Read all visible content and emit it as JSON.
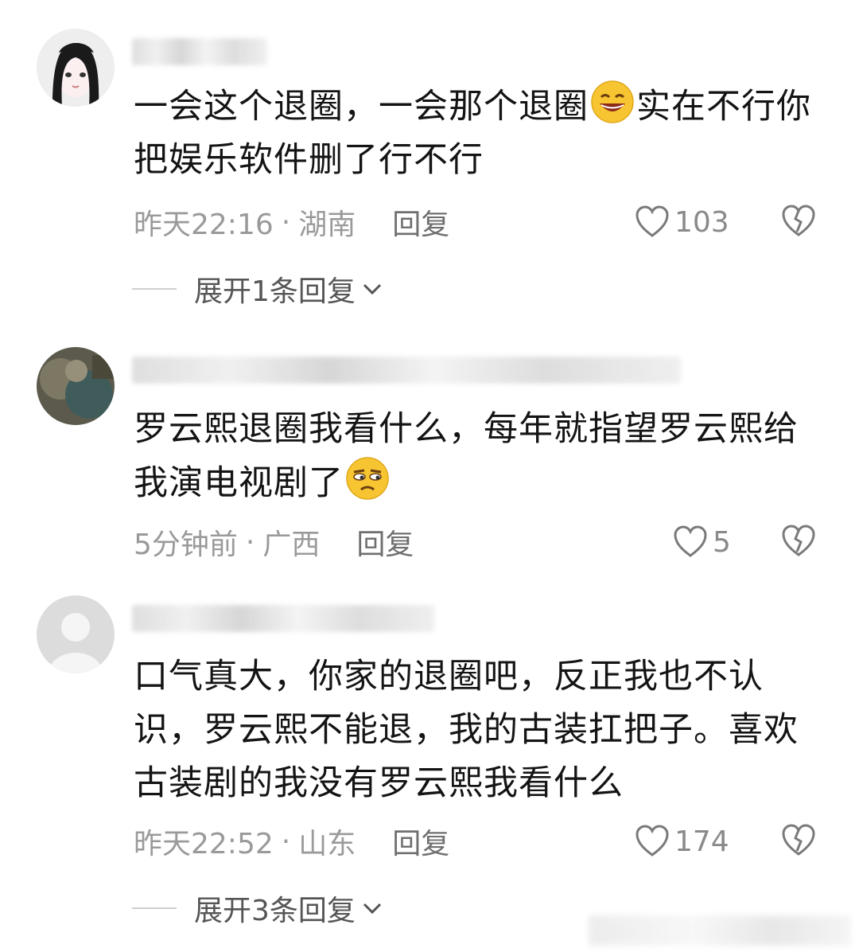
{
  "comments": [
    {
      "text_before_emoji": "一会这个退圈，一会那个退圈",
      "emoji": "grinning-emoji",
      "text_after_emoji": "实在不行你把娱乐软件删了行不行",
      "time": "昨天22:16",
      "separator": "·",
      "location": "湖南",
      "reply_label": "回复",
      "likes": "103",
      "expand_label": "展开1条回复"
    },
    {
      "text_before_emoji": "罗云熙退圈我看什么，每年就指望罗云熙给我演电视剧了",
      "emoji": "unamused-emoji",
      "text_after_emoji": "",
      "time": "5分钟前",
      "separator": "·",
      "location": "广西",
      "reply_label": "回复",
      "likes": "5"
    },
    {
      "text_before_emoji": "口气真大，你家的退圈吧，反正我也不认识，罗云熙不能退，我的古装扛把子。喜欢古装剧的我没有罗云熙我看什么",
      "time": "昨天22:52",
      "separator": "·",
      "location": "山东",
      "reply_label": "回复",
      "likes": "174",
      "expand_label": "展开3条回复"
    }
  ],
  "icons": {
    "like": "heart-outline-icon",
    "dislike": "broken-heart-icon",
    "expand": "chevron-down-icon"
  },
  "colors": {
    "text": "#141414",
    "meta": "#9a9a9a",
    "reply": "#6f6f6f",
    "emoji_yellow": "#f7c531"
  }
}
